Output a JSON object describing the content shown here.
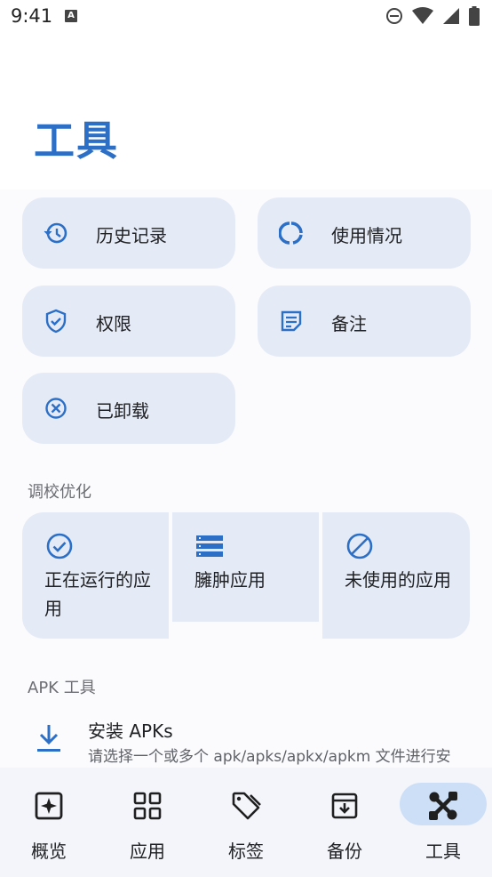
{
  "status_bar": {
    "time": "9:41",
    "notification_glyph": "A"
  },
  "page": {
    "title": "工具"
  },
  "tools": [
    {
      "label": "历史记录",
      "icon": "history-icon"
    },
    {
      "label": "使用情况",
      "icon": "usage-icon"
    },
    {
      "label": "权限",
      "icon": "shield-icon"
    },
    {
      "label": "备注",
      "icon": "note-icon"
    },
    {
      "label": "已卸载",
      "icon": "uninstalled-icon"
    }
  ],
  "optimization": {
    "section_title": "调校优化",
    "items": [
      {
        "label": "正在运行的应用",
        "icon": "check-circle-icon"
      },
      {
        "label": "臃肿应用",
        "icon": "list-icon"
      },
      {
        "label": "未使用的应用",
        "icon": "block-icon"
      }
    ]
  },
  "apk_tools": {
    "section_title": "APK 工具",
    "install": {
      "title": "安装 APKs",
      "description": "请选择一个或多个 apk/apks/apkx/apkm 文件进行安",
      "icon": "download-icon"
    }
  },
  "nav": {
    "active": "工具",
    "items": [
      {
        "label": "概览",
        "icon": "overview-icon"
      },
      {
        "label": "应用",
        "icon": "grid-icon"
      },
      {
        "label": "标签",
        "icon": "tag-icon"
      },
      {
        "label": "备份",
        "icon": "archive-icon"
      },
      {
        "label": "工具",
        "icon": "tools-icon"
      }
    ]
  },
  "colors": {
    "accent": "#2c6fc7",
    "tile": "#e5ebf6",
    "nav_active": "#cddff7"
  }
}
